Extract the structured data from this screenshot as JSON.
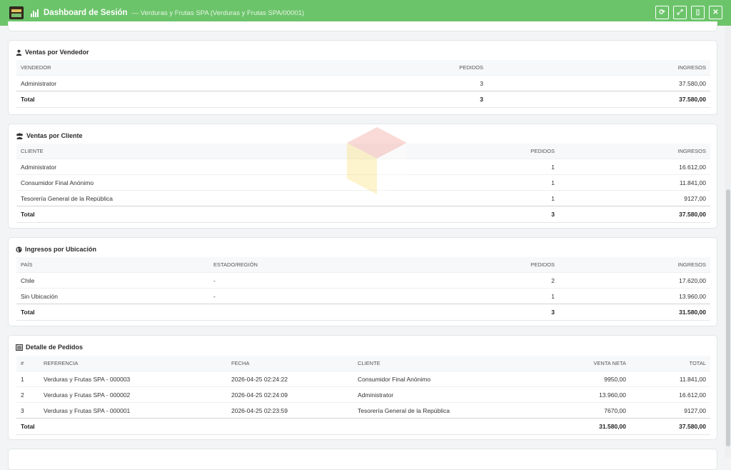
{
  "header": {
    "title": "Dashboard de Sesión",
    "subtitle": "— Verduras y Frutas SPA (Verduras y Frutas SPA/00001)",
    "actions": [
      {
        "icon": "refresh-icon",
        "glyph": "⟳"
      },
      {
        "icon": "expand-icon",
        "glyph": "⤢"
      },
      {
        "icon": "pdf-icon",
        "glyph": "▯"
      },
      {
        "icon": "close-icon",
        "glyph": "✕"
      }
    ]
  },
  "vendedor": {
    "title": "Ventas por Vendedor",
    "headers": [
      "VENDEDOR",
      "PEDIDOS",
      "INGRESOS"
    ],
    "rows": [
      [
        "Administrator",
        "3",
        "37.580,00"
      ]
    ],
    "total": [
      "Total",
      "3",
      "37.580,00"
    ]
  },
  "cliente": {
    "title": "Ventas por Cliente",
    "headers": [
      "CLIENTE",
      "PEDIDOS",
      "INGRESOS"
    ],
    "rows": [
      [
        "Administrator",
        "1",
        "16.612,00"
      ],
      [
        "Consumidor Final Anónimo",
        "1",
        "11.841,00"
      ],
      [
        "Tesorería General de la República",
        "1",
        "9127,00"
      ]
    ],
    "total": [
      "Total",
      "3",
      "37.580,00"
    ]
  },
  "ubicacion": {
    "title": "Ingresos por Ubicación",
    "headers": [
      "PAÍS",
      "ESTADO/REGIÓN",
      "PEDIDOS",
      "INGRESOS"
    ],
    "rows": [
      [
        "Chile",
        "-",
        "2",
        "17.620,00"
      ],
      [
        "Sin Ubicación",
        "-",
        "1",
        "13.960,00"
      ]
    ],
    "total": [
      "Total",
      "",
      "3",
      "31.580,00"
    ]
  },
  "pedidos": {
    "title": "Detalle de Pedidos",
    "headers": [
      "#",
      "REFERENCIA",
      "FECHA",
      "CLIENTE",
      "VENTA NETA",
      "TOTAL"
    ],
    "rows": [
      [
        "1",
        "Verduras y Frutas SPA - 000003",
        "2026-04-25 02:24:22",
        "Consumidor Final Anónimo",
        "9950,00",
        "11.841,00"
      ],
      [
        "2",
        "Verduras y Frutas SPA - 000002",
        "2026-04-25 02:24:09",
        "Administrator",
        "13.960,00",
        "16.612,00"
      ],
      [
        "3",
        "Verduras y Frutas SPA - 000001",
        "2026-04-25 02:23:59",
        "Tesorería General de la República",
        "7670,00",
        "9127,00"
      ]
    ],
    "total": [
      "Total",
      "",
      "",
      "",
      "31.580,00",
      "37.580,00"
    ]
  }
}
